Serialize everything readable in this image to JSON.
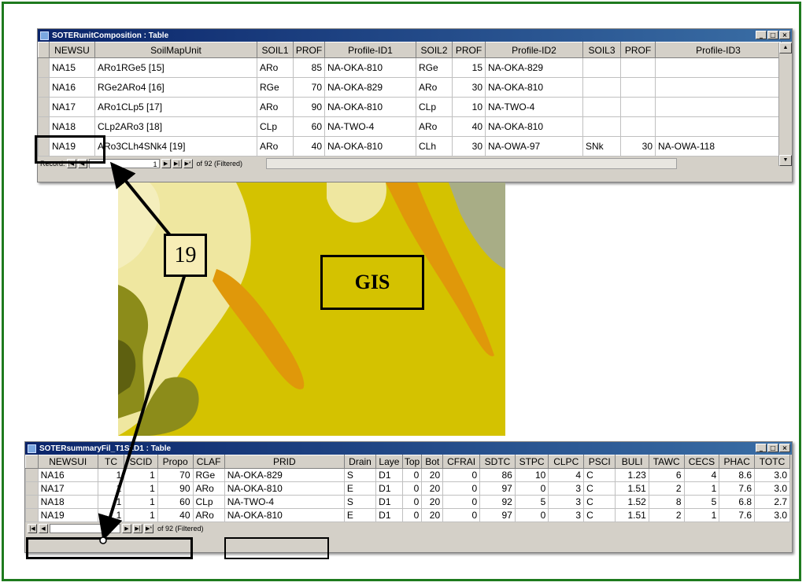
{
  "win1": {
    "title": "SOTERunitComposition : Table",
    "columns": [
      "NEWSU",
      "SoilMapUnit",
      "SOIL1",
      "PROF",
      "Profile-ID1",
      "SOIL2",
      "PROF",
      "Profile-ID2",
      "SOIL3",
      "PROF",
      "Profile-ID3"
    ],
    "rows": [
      [
        "NA15",
        "ARo1RGe5 [15]",
        "ARo",
        "85",
        "NA-OKA-810",
        "RGe",
        "15",
        "NA-OKA-829",
        "",
        "",
        ""
      ],
      [
        "NA16",
        "RGe2ARo4 [16]",
        "RGe",
        "70",
        "NA-OKA-829",
        "ARo",
        "30",
        "NA-OKA-810",
        "",
        "",
        ""
      ],
      [
        "NA17",
        "ARo1CLp5 [17]",
        "ARo",
        "90",
        "NA-OKA-810",
        "CLp",
        "10",
        "NA-TWO-4",
        "",
        "",
        ""
      ],
      [
        "NA18",
        "CLp2ARo3 [18]",
        "CLp",
        "60",
        "NA-TWO-4",
        "ARo",
        "40",
        "NA-OKA-810",
        "",
        "",
        ""
      ],
      [
        "NA19",
        "ARo3CLh4SNk4 [19]",
        "ARo",
        "40",
        "NA-OKA-810",
        "CLh",
        "30",
        "NA-OWA-97",
        "SNk",
        "30",
        "NA-OWA-118"
      ]
    ],
    "record_label": "Record:",
    "record_value": "1",
    "record_of": "of  92 (Filtered)"
  },
  "map": {
    "unit_label": "19",
    "gis_label": "GIS"
  },
  "win2": {
    "title": "SOTERsummaryFil_T1S1D1 : Table",
    "columns": [
      "NEWSUI",
      "TC",
      "SCID",
      "Propo",
      "CLAF",
      "PRID",
      "Drain",
      "Laye",
      "Top",
      "Bot",
      "CFRAI",
      "SDTC",
      "STPC",
      "CLPC",
      "PSCI",
      "BULI",
      "TAWC",
      "CECS",
      "PHAC",
      "TOTC"
    ],
    "rows": [
      [
        "NA16",
        "1",
        "1",
        "70",
        "RGe",
        "NA-OKA-829",
        "S",
        "D1",
        "0",
        "20",
        "0",
        "86",
        "10",
        "4",
        "C",
        "1.23",
        "6",
        "4",
        "8.6",
        "3.0"
      ],
      [
        "NA17",
        "1",
        "1",
        "90",
        "ARo",
        "NA-OKA-810",
        "E",
        "D1",
        "0",
        "20",
        "0",
        "97",
        "0",
        "3",
        "C",
        "1.51",
        "2",
        "1",
        "7.6",
        "3.0"
      ],
      [
        "NA18",
        "1",
        "1",
        "60",
        "CLp",
        "NA-TWO-4",
        "S",
        "D1",
        "0",
        "20",
        "0",
        "92",
        "5",
        "3",
        "C",
        "1.52",
        "8",
        "5",
        "6.8",
        "2.7"
      ],
      [
        "NA19",
        "1",
        "1",
        "40",
        "ARo",
        "NA-OKA-810",
        "E",
        "D1",
        "0",
        "20",
        "0",
        "97",
        "0",
        "3",
        "C",
        "1.51",
        "2",
        "1",
        "7.6",
        "3.0"
      ]
    ],
    "record_of": "of  92 (Filtered)"
  },
  "colors": {
    "frame": "#1e7a1e",
    "title_bar": "#0a246a",
    "map_yellow": "#d4c200",
    "map_light": "#efe7a0",
    "map_orange": "#e0980a",
    "map_olive": "#8c8c1a",
    "map_sage": "#a8ad86"
  }
}
